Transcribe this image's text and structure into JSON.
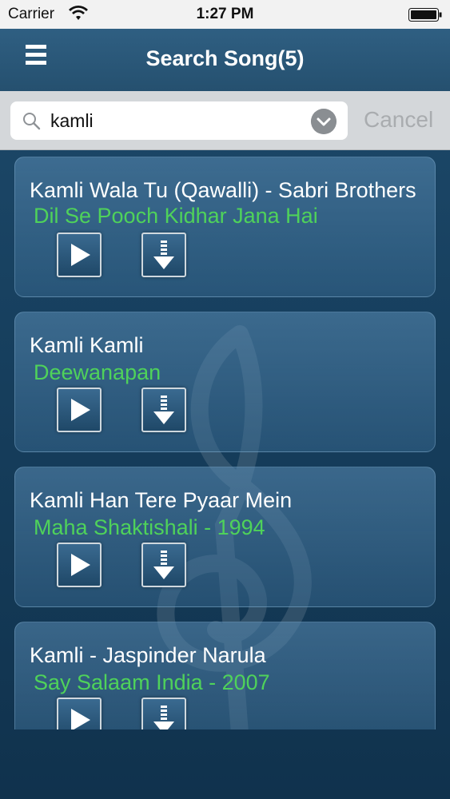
{
  "status_bar": {
    "carrier": "Carrier",
    "time": "1:27 PM"
  },
  "nav": {
    "title": "Search Song(5)",
    "menu_icon": "hamburger-menu-icon"
  },
  "search": {
    "value": "kamli",
    "cancel_label": "Cancel",
    "icon": "search-icon",
    "clear_icon": "chevron-down-icon"
  },
  "colors": {
    "album_text": "#4fd25a",
    "nav_bg": "#2f5f82",
    "search_bar_bg": "#d4d7da"
  },
  "songs": [
    {
      "title": "Kamli Wala Tu (Qawalli) - Sabri Brothers",
      "album": "Dil Se Pooch Kidhar Jana Hai"
    },
    {
      "title": "Kamli Kamli",
      "album": "Deewanapan"
    },
    {
      "title": "Kamli Han Tere Pyaar Mein",
      "album": "Maha Shaktishali - 1994"
    },
    {
      "title": "Kamli - Jaspinder Narula",
      "album": "Say Salaam India - 2007"
    }
  ]
}
